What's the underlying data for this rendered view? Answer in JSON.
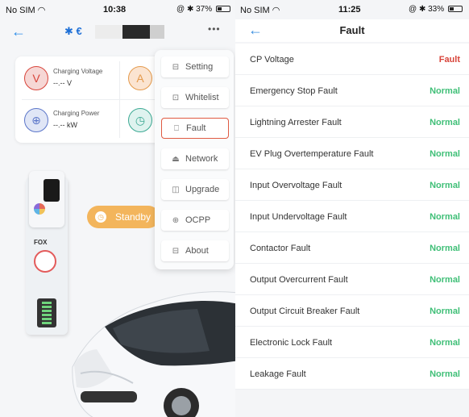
{
  "colors": {
    "accent_blue": "#2f8ee8",
    "normal_green": "#3fbf77",
    "fault_red": "#d8443a",
    "standby_orange": "#f3b55c",
    "active_border": "#e05a42"
  },
  "left": {
    "status": {
      "carrier": "No SIM",
      "time": "10:38",
      "battery": "37%",
      "battery_level": 0.37
    },
    "nav": {
      "bt_name": "€",
      "more": "•••"
    },
    "metrics": [
      {
        "label": "Charging Voltage",
        "value": "--.-- V",
        "icon": "plug-icon",
        "glyph": "V",
        "color": "#f6d7d5",
        "fg": "#d8443a"
      },
      {
        "label": "",
        "value": "",
        "icon": "current-icon",
        "glyph": "A",
        "color": "#fbe4d1",
        "fg": "#e49a4c"
      },
      {
        "label": "Charging Power",
        "value": "--.-- kW",
        "icon": "power-icon",
        "glyph": "⊕",
        "color": "#e0e6f6",
        "fg": "#5b76c9"
      },
      {
        "label": "",
        "value": "",
        "icon": "timer-icon",
        "glyph": "◷",
        "color": "#dff3ef",
        "fg": "#3ba993"
      }
    ],
    "standby": "Standby",
    "charger_logo": "FOX",
    "menu": [
      {
        "label": "Setting",
        "icon": "settings-icon",
        "glyph": "⊟",
        "active": false
      },
      {
        "label": "Whitelist",
        "icon": "whitelist-icon",
        "glyph": "⊡",
        "active": false
      },
      {
        "label": "Fault",
        "icon": "fault-icon",
        "glyph": "⎕",
        "active": true
      },
      {
        "label": "Network",
        "icon": "network-icon",
        "glyph": "⏏",
        "active": false
      },
      {
        "label": "Upgrade",
        "icon": "upgrade-icon",
        "glyph": "◫",
        "active": false
      },
      {
        "label": "OCPP",
        "icon": "ocpp-icon",
        "glyph": "⊕",
        "active": false
      },
      {
        "label": "About",
        "icon": "about-icon",
        "glyph": "⊟",
        "active": false
      }
    ]
  },
  "right": {
    "status": {
      "carrier": "No SIM",
      "time": "11:25",
      "battery": "33%",
      "battery_level": 0.33
    },
    "title": "Fault",
    "faults": [
      {
        "name": "CP Voltage",
        "status": "Fault",
        "state": "fault"
      },
      {
        "name": "Emergency Stop Fault",
        "status": "Normal",
        "state": "normal"
      },
      {
        "name": "Lightning Arrester Fault",
        "status": "Normal",
        "state": "normal"
      },
      {
        "name": "EV Plug Overtemperature Fault",
        "status": "Normal",
        "state": "normal"
      },
      {
        "name": "Input Overvoltage Fault",
        "status": "Normal",
        "state": "normal"
      },
      {
        "name": "Input Undervoltage Fault",
        "status": "Normal",
        "state": "normal"
      },
      {
        "name": "Contactor Fault",
        "status": "Normal",
        "state": "normal"
      },
      {
        "name": "Output Overcurrent Fault",
        "status": "Normal",
        "state": "normal"
      },
      {
        "name": "Output Circuit Breaker Fault",
        "status": "Normal",
        "state": "normal"
      },
      {
        "name": "Electronic Lock Fault",
        "status": "Normal",
        "state": "normal"
      },
      {
        "name": "Leakage Fault",
        "status": "Normal",
        "state": "normal"
      }
    ]
  }
}
